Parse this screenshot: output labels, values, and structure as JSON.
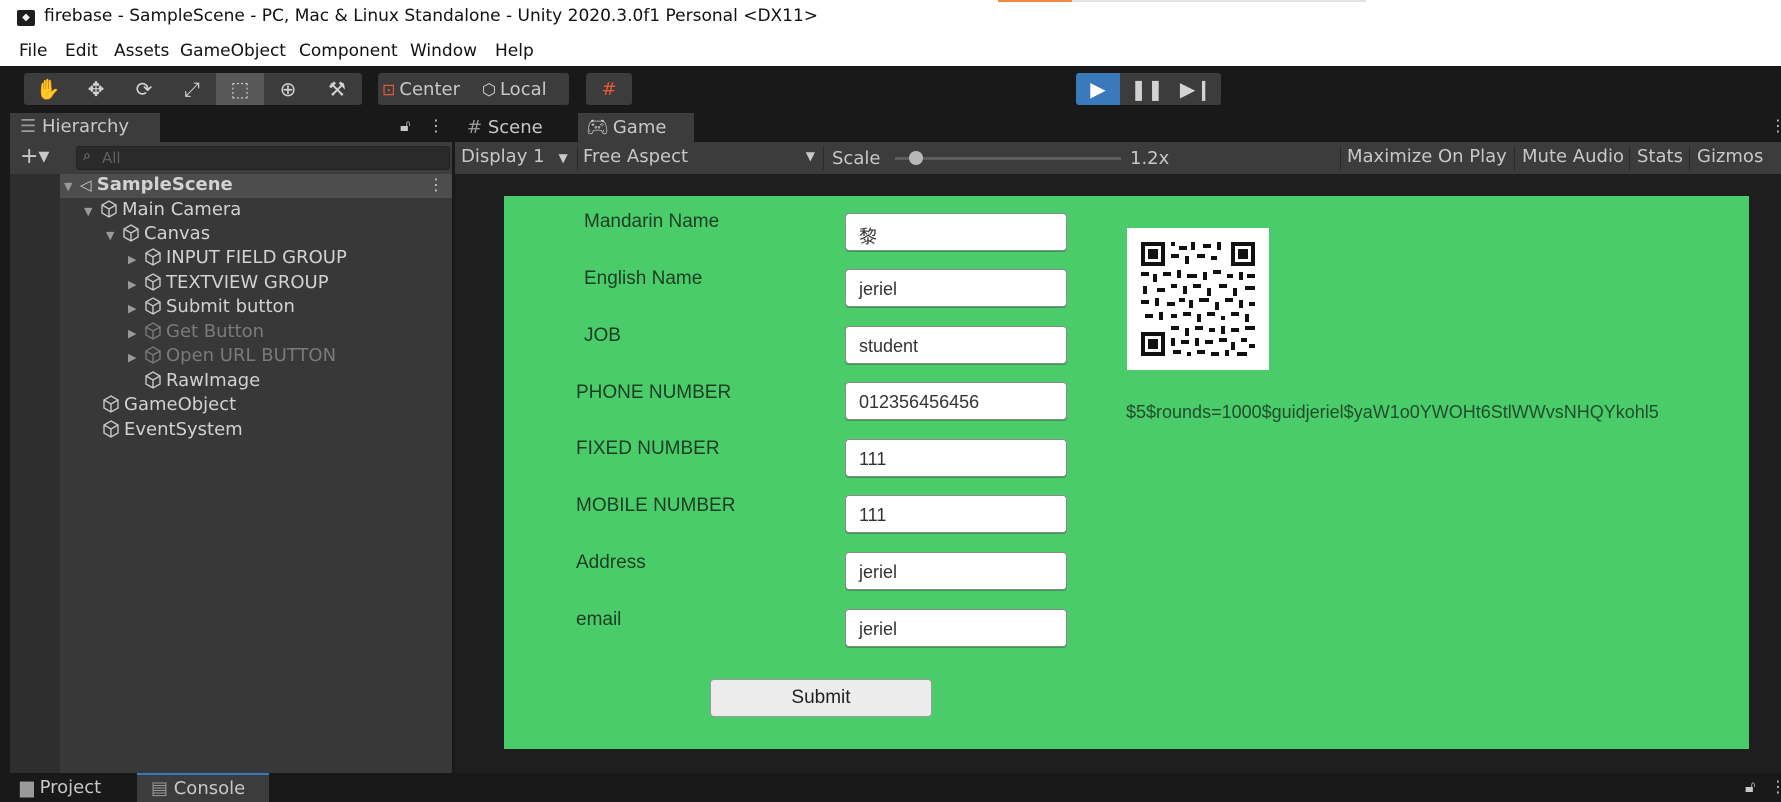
{
  "window": {
    "title": "firebase - SampleScene - PC, Mac & Linux Standalone - Unity 2020.3.0f1 Personal <DX11>"
  },
  "menu": [
    "File",
    "Edit",
    "Assets",
    "GameObject",
    "Component",
    "Window",
    "Help"
  ],
  "toolbar": {
    "tools": [
      "hand-tool-icon",
      "move-tool-icon",
      "rotate-tool-icon",
      "scale-tool-icon",
      "rect-tool-icon",
      "transform-tool-icon",
      "custom-tool-icon"
    ],
    "active_tool": "rect-tool-icon",
    "pivot_mode": "Center",
    "pivot_rotation": "Local"
  },
  "hierarchy": {
    "tab_label": "Hierarchy",
    "search_placeholder": "All",
    "scene": "SampleScene",
    "items": [
      {
        "label": "Main Camera",
        "expanded": true
      },
      {
        "label": "Canvas",
        "expanded": true
      },
      {
        "label": "INPUT FIELD GROUP"
      },
      {
        "label": "TEXTVIEW GROUP"
      },
      {
        "label": "Submit button"
      },
      {
        "label": "Get Button",
        "disabled": true
      },
      {
        "label": "Open URL BUTTON",
        "disabled": true
      },
      {
        "label": "RawImage"
      },
      {
        "label": "GameObject"
      },
      {
        "label": "EventSystem"
      }
    ]
  },
  "game_view": {
    "tabs": [
      "Scene",
      "Game"
    ],
    "active_tab": "Game",
    "display": "Display 1",
    "aspect": "Free Aspect",
    "scale_label": "Scale",
    "scale_value": "1.2x",
    "buttons": [
      "Maximize On Play",
      "Mute Audio",
      "Stats",
      "Gizmos"
    ]
  },
  "form": {
    "fields": [
      {
        "label": "Mandarin Name",
        "value": "黎"
      },
      {
        "label": "English Name",
        "value": "jeriel"
      },
      {
        "label": "JOB",
        "value": "student"
      },
      {
        "label": "PHONE NUMBER",
        "value": "012356456456"
      },
      {
        "label": "FIXED NUMBER",
        "value": "111"
      },
      {
        "label": "MOBILE NUMBER",
        "value": "111"
      },
      {
        "label": "Address",
        "value": "jeriel"
      },
      {
        "label": "email",
        "value": "jeriel"
      }
    ],
    "submit_label": "Submit",
    "hash_text": "$5$rounds=1000$guidjeriel$yaW1o0YWOHt6StlWWvsNHQYkohl5",
    "canvas_color": "#4bcc6a"
  },
  "bottom": {
    "tabs": [
      "Project",
      "Console"
    ],
    "active_tab": "Console"
  },
  "colors": {
    "editor_dark": "#191919",
    "panel": "#383838",
    "play_active": "#3a79bb"
  }
}
